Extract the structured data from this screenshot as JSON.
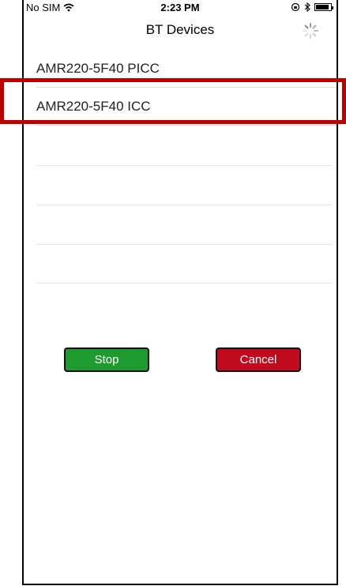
{
  "status_bar": {
    "carrier": "No SIM",
    "time": "2:23 PM"
  },
  "nav": {
    "title": "BT Devices"
  },
  "devices": [
    {
      "name": "AMR220-5F40 PICC"
    },
    {
      "name": "AMR220-5F40 ICC"
    }
  ],
  "buttons": {
    "stop_label": "Stop",
    "cancel_label": "Cancel"
  },
  "colors": {
    "stop_bg": "#1e9b2f",
    "cancel_bg": "#c00b1e",
    "highlight": "#c00000"
  },
  "icons": [
    "wifi-icon",
    "rotation-lock-icon",
    "bluetooth-icon",
    "battery-icon",
    "activity-spinner-icon"
  ]
}
